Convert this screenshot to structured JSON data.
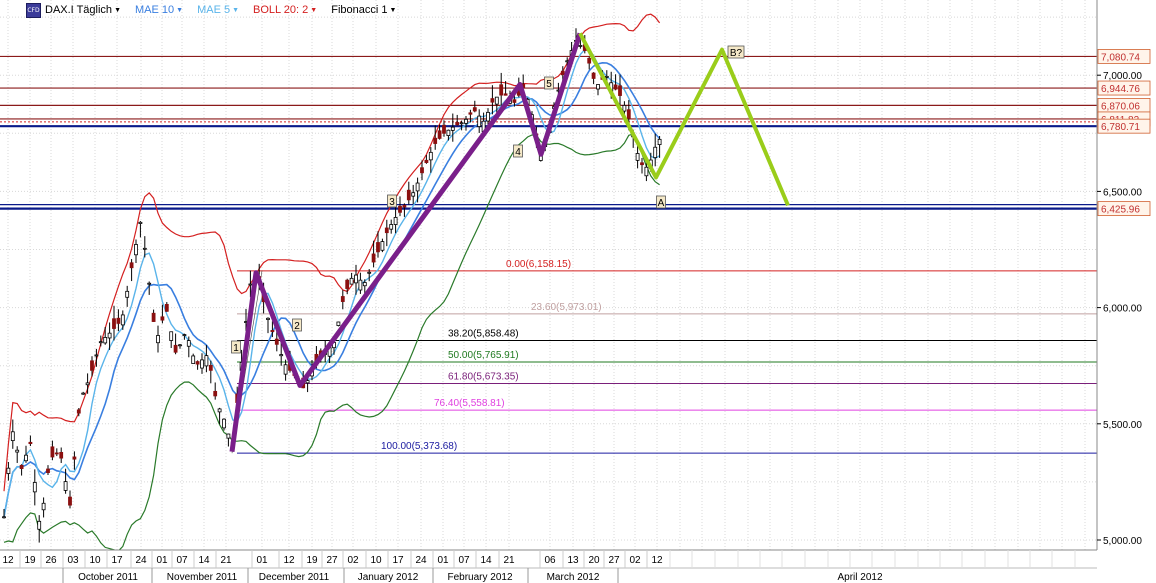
{
  "toolbar": {
    "symbol_icon": "cfd-chart-icon",
    "items": [
      {
        "label": "DAX.I Täglich",
        "color": "#000000"
      },
      {
        "label": "MAE 10",
        "color": "#3a7fe0"
      },
      {
        "label": "MAE 5",
        "color": "#5ab4ea"
      },
      {
        "label": "BOLL 20: 2",
        "color": "#d42020"
      },
      {
        "label": "Fibonacci 1",
        "color": "#000000"
      }
    ]
  },
  "chart_data": {
    "type": "candlestick",
    "ylim": [
      4950,
      7330
    ],
    "y_ticks": [
      {
        "value": 5000,
        "label": "5,000.00"
      },
      {
        "value": 5500,
        "label": "5,500.00"
      },
      {
        "value": 6000,
        "label": "6,000.00"
      },
      {
        "value": 6500,
        "label": "6,500.00"
      },
      {
        "value": 7000,
        "label": "7,000.00"
      }
    ],
    "x_day_labels": [
      "12",
      "19",
      "26",
      "03",
      "10",
      "17",
      "24",
      "01",
      "07",
      "14",
      "21",
      "01",
      "12",
      "19",
      "27",
      "02",
      "10",
      "17",
      "24",
      "01",
      "07",
      "14",
      "21",
      "06",
      "13",
      "20",
      "27",
      "02",
      "12"
    ],
    "x_month_labels": [
      "October 2011",
      "November 2011",
      "December 2011",
      "January 2012",
      "February 2012",
      "March 2012",
      "April 2012"
    ],
    "price_levels": [
      {
        "label": "7,080.74",
        "value": 7080.74,
        "color": "#8b1a1a"
      },
      {
        "label": "6,944.76",
        "value": 6944.76,
        "color": "#8b1a1a"
      },
      {
        "label": "6,870.06",
        "value": 6870.06,
        "color": "#8b1a1a"
      },
      {
        "label": "6,811.82",
        "value": 6811.82,
        "color": "#8b1a1a"
      },
      {
        "label": "6,780.71",
        "value": 6780.71,
        "color": "#0a1a8a"
      },
      {
        "label": "6,425.96",
        "value": 6425.96,
        "color": "#0a1a8a"
      }
    ],
    "fibonacci": [
      {
        "label": "0.00(6,158.15)",
        "value": 6158.15,
        "color": "#d42020"
      },
      {
        "label": "23.60(5,973.01)",
        "value": 5973.01,
        "color": "#c0a0a0"
      },
      {
        "label": "38.20(5,858.48)",
        "value": 5858.48,
        "color": "#000000"
      },
      {
        "label": "50.00(5,765.91)",
        "value": 5765.91,
        "color": "#1f7a1f"
      },
      {
        "label": "61.80(5,673.35)",
        "value": 5673.35,
        "color": "#7a1f7a"
      },
      {
        "label": "76.40(5,558.81)",
        "value": 5558.81,
        "color": "#e040e0"
      },
      {
        "label": "100.00(5,373.68)",
        "value": 5373.68,
        "color": "#1a1aa0"
      }
    ],
    "wave_labels": [
      "1",
      "2",
      "3",
      "4",
      "5",
      "A",
      "B?"
    ],
    "series": [
      {
        "name": "MAE 10",
        "color": "#3a7fe0"
      },
      {
        "name": "MAE 5",
        "color": "#5ab4ea"
      },
      {
        "name": "BOLL 20: 2",
        "color": "#d42020"
      }
    ]
  }
}
